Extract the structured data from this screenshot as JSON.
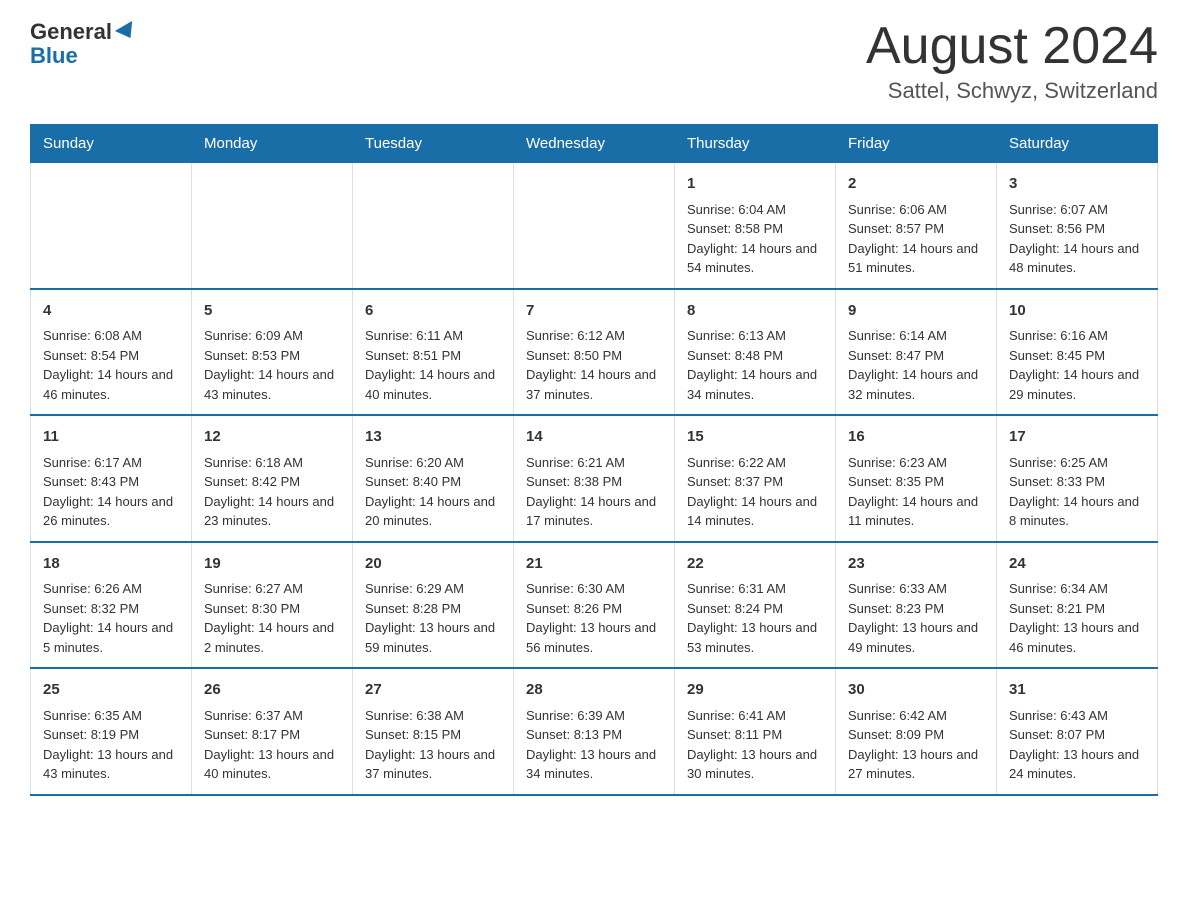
{
  "header": {
    "logo_general": "General",
    "logo_blue": "Blue",
    "month_title": "August 2024",
    "location": "Sattel, Schwyz, Switzerland"
  },
  "weekdays": [
    "Sunday",
    "Monday",
    "Tuesday",
    "Wednesday",
    "Thursday",
    "Friday",
    "Saturday"
  ],
  "weeks": [
    [
      {
        "day": "",
        "info": ""
      },
      {
        "day": "",
        "info": ""
      },
      {
        "day": "",
        "info": ""
      },
      {
        "day": "",
        "info": ""
      },
      {
        "day": "1",
        "info": "Sunrise: 6:04 AM\nSunset: 8:58 PM\nDaylight: 14 hours and 54 minutes."
      },
      {
        "day": "2",
        "info": "Sunrise: 6:06 AM\nSunset: 8:57 PM\nDaylight: 14 hours and 51 minutes."
      },
      {
        "day": "3",
        "info": "Sunrise: 6:07 AM\nSunset: 8:56 PM\nDaylight: 14 hours and 48 minutes."
      }
    ],
    [
      {
        "day": "4",
        "info": "Sunrise: 6:08 AM\nSunset: 8:54 PM\nDaylight: 14 hours and 46 minutes."
      },
      {
        "day": "5",
        "info": "Sunrise: 6:09 AM\nSunset: 8:53 PM\nDaylight: 14 hours and 43 minutes."
      },
      {
        "day": "6",
        "info": "Sunrise: 6:11 AM\nSunset: 8:51 PM\nDaylight: 14 hours and 40 minutes."
      },
      {
        "day": "7",
        "info": "Sunrise: 6:12 AM\nSunset: 8:50 PM\nDaylight: 14 hours and 37 minutes."
      },
      {
        "day": "8",
        "info": "Sunrise: 6:13 AM\nSunset: 8:48 PM\nDaylight: 14 hours and 34 minutes."
      },
      {
        "day": "9",
        "info": "Sunrise: 6:14 AM\nSunset: 8:47 PM\nDaylight: 14 hours and 32 minutes."
      },
      {
        "day": "10",
        "info": "Sunrise: 6:16 AM\nSunset: 8:45 PM\nDaylight: 14 hours and 29 minutes."
      }
    ],
    [
      {
        "day": "11",
        "info": "Sunrise: 6:17 AM\nSunset: 8:43 PM\nDaylight: 14 hours and 26 minutes."
      },
      {
        "day": "12",
        "info": "Sunrise: 6:18 AM\nSunset: 8:42 PM\nDaylight: 14 hours and 23 minutes."
      },
      {
        "day": "13",
        "info": "Sunrise: 6:20 AM\nSunset: 8:40 PM\nDaylight: 14 hours and 20 minutes."
      },
      {
        "day": "14",
        "info": "Sunrise: 6:21 AM\nSunset: 8:38 PM\nDaylight: 14 hours and 17 minutes."
      },
      {
        "day": "15",
        "info": "Sunrise: 6:22 AM\nSunset: 8:37 PM\nDaylight: 14 hours and 14 minutes."
      },
      {
        "day": "16",
        "info": "Sunrise: 6:23 AM\nSunset: 8:35 PM\nDaylight: 14 hours and 11 minutes."
      },
      {
        "day": "17",
        "info": "Sunrise: 6:25 AM\nSunset: 8:33 PM\nDaylight: 14 hours and 8 minutes."
      }
    ],
    [
      {
        "day": "18",
        "info": "Sunrise: 6:26 AM\nSunset: 8:32 PM\nDaylight: 14 hours and 5 minutes."
      },
      {
        "day": "19",
        "info": "Sunrise: 6:27 AM\nSunset: 8:30 PM\nDaylight: 14 hours and 2 minutes."
      },
      {
        "day": "20",
        "info": "Sunrise: 6:29 AM\nSunset: 8:28 PM\nDaylight: 13 hours and 59 minutes."
      },
      {
        "day": "21",
        "info": "Sunrise: 6:30 AM\nSunset: 8:26 PM\nDaylight: 13 hours and 56 minutes."
      },
      {
        "day": "22",
        "info": "Sunrise: 6:31 AM\nSunset: 8:24 PM\nDaylight: 13 hours and 53 minutes."
      },
      {
        "day": "23",
        "info": "Sunrise: 6:33 AM\nSunset: 8:23 PM\nDaylight: 13 hours and 49 minutes."
      },
      {
        "day": "24",
        "info": "Sunrise: 6:34 AM\nSunset: 8:21 PM\nDaylight: 13 hours and 46 minutes."
      }
    ],
    [
      {
        "day": "25",
        "info": "Sunrise: 6:35 AM\nSunset: 8:19 PM\nDaylight: 13 hours and 43 minutes."
      },
      {
        "day": "26",
        "info": "Sunrise: 6:37 AM\nSunset: 8:17 PM\nDaylight: 13 hours and 40 minutes."
      },
      {
        "day": "27",
        "info": "Sunrise: 6:38 AM\nSunset: 8:15 PM\nDaylight: 13 hours and 37 minutes."
      },
      {
        "day": "28",
        "info": "Sunrise: 6:39 AM\nSunset: 8:13 PM\nDaylight: 13 hours and 34 minutes."
      },
      {
        "day": "29",
        "info": "Sunrise: 6:41 AM\nSunset: 8:11 PM\nDaylight: 13 hours and 30 minutes."
      },
      {
        "day": "30",
        "info": "Sunrise: 6:42 AM\nSunset: 8:09 PM\nDaylight: 13 hours and 27 minutes."
      },
      {
        "day": "31",
        "info": "Sunrise: 6:43 AM\nSunset: 8:07 PM\nDaylight: 13 hours and 24 minutes."
      }
    ]
  ]
}
